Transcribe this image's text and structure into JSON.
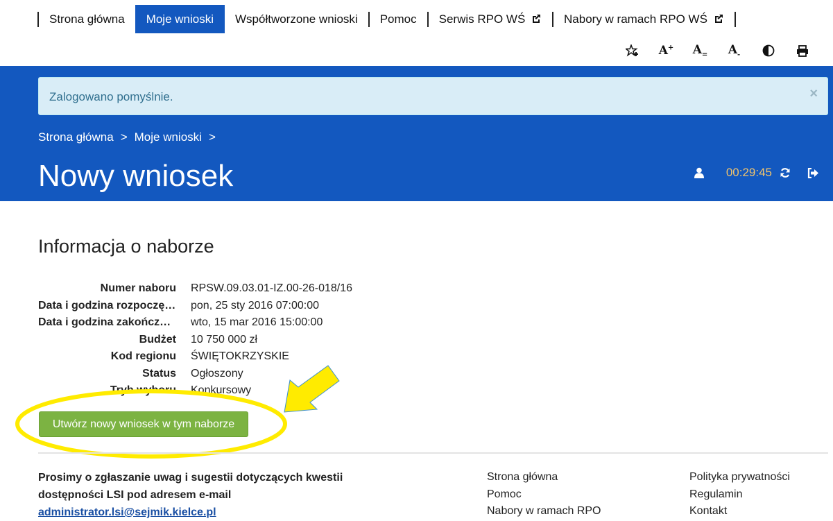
{
  "nav": {
    "items": [
      {
        "label": "Strona główna"
      },
      {
        "label": "Moje wnioski"
      },
      {
        "label": "Współtworzone wnioski"
      },
      {
        "label": "Pomoc"
      },
      {
        "label": "Serwis RPO WŚ"
      },
      {
        "label": "Nabory w ramach RPO WŚ"
      }
    ],
    "active": "Moje wnioski"
  },
  "toolbar": {
    "icons": [
      "star-plus-icon",
      "font-increase-icon",
      "font-default-icon",
      "font-decrease-icon",
      "contrast-icon",
      "print-icon"
    ]
  },
  "alert": {
    "message": "Zalogowano pomyślnie.",
    "close": "×"
  },
  "breadcrumb": {
    "items": [
      "Strona główna",
      "Moje wnioski"
    ],
    "separator": ">"
  },
  "page": {
    "title": "Nowy wniosek"
  },
  "session": {
    "timer": "00:29:45"
  },
  "recruitment": {
    "heading": "Informacja o naborze",
    "fields": [
      {
        "label": "Numer naboru",
        "value": "RPSW.09.03.01-IZ.00-26-018/16"
      },
      {
        "label": "Data i godzina rozpoczęcia",
        "value": "pon, 25 sty 2016 07:00:00"
      },
      {
        "label": "Data i godzina zakończenia",
        "value": "wto, 15 mar 2016 15:00:00"
      },
      {
        "label": "Budżet",
        "value": "10 750 000 zł"
      },
      {
        "label": "Kod regionu",
        "value": "ŚWIĘTOKRZYSKIE"
      },
      {
        "label": "Status",
        "value": "Ogłoszony"
      },
      {
        "label": "Tryb wyboru",
        "value": "Konkursowy"
      }
    ],
    "create_button": "Utwórz nowy wniosek w tym naborze"
  },
  "colors": {
    "brand_blue": "#1358bf",
    "button_green": "#7cb342",
    "highlight_yellow": "#ffeb00",
    "timer": "#f0c36d"
  },
  "footer": {
    "note_line1": "Prosimy o zgłaszanie uwag i sugestii dotyczących kwestii",
    "note_line2": "dostępności LSI pod adresem e-mail",
    "email": "administrator.lsi@sejmik.kielce.pl",
    "col1": [
      "Strona główna",
      "Pomoc",
      "Nabory w ramach RPO"
    ],
    "col2": [
      "Polityka prywatności",
      "Regulamin",
      "Kontakt"
    ]
  }
}
